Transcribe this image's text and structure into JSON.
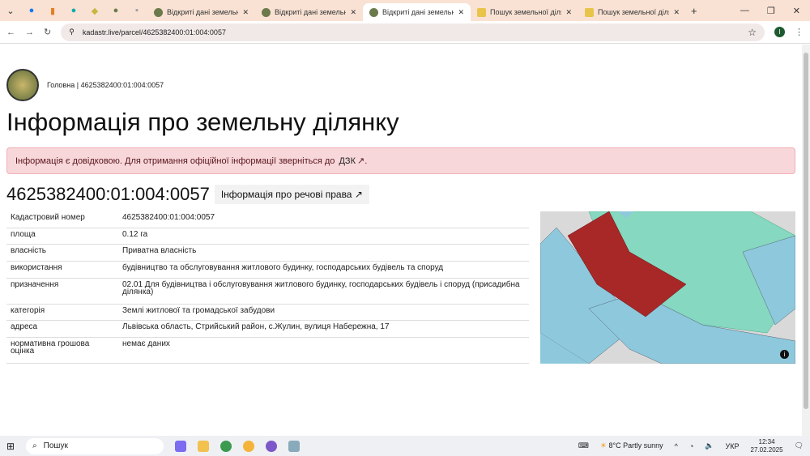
{
  "browser": {
    "tabs": [
      {
        "title": "Відкриті дані земельного",
        "active": false
      },
      {
        "title": "Відкриті дані земельного",
        "active": false
      },
      {
        "title": "Відкриті дані земельного",
        "active": true
      },
      {
        "title": "Пошук земельної ділянки",
        "active": false
      },
      {
        "title": "Пошук земельної ділянки",
        "active": false
      }
    ],
    "url": "kadastr.live/parcel/4625382400:01:004:0057",
    "profile_initial": "I"
  },
  "breadcrumb": {
    "home": "Головна",
    "separator": "|",
    "current": "4625382400:01:004:0057"
  },
  "title": "Інформація про земельну ділянку",
  "alert": {
    "text": "Інформація є довідковою. Для отримання офіційної інформації зверніться до",
    "link": "ДЗК",
    "end": "."
  },
  "parcel": {
    "number": "4625382400:01:004:0057",
    "rights_button": "Інформація про речові права"
  },
  "rows": [
    {
      "label": "Кадастровий номер",
      "value": "4625382400:01:004:0057"
    },
    {
      "label": "площа",
      "value": "0.12 га"
    },
    {
      "label": "власність",
      "value": "Приватна власність"
    },
    {
      "label": "використання",
      "value": "будівництво та обслуговування житлового будинку, господарських будівель та споруд"
    },
    {
      "label": "призначення",
      "value": "02.01 Для будівництва і обслуговування житлового будинку, господарських будівель і споруд (присадибна ділянка)"
    },
    {
      "label": "категорія",
      "value": "Землі житлової та громадської забудови"
    },
    {
      "label": "адреса",
      "value": "Львівська область, Стрийський район, с.Жулин, вулиця Набережна, 17"
    },
    {
      "label": "нормативна грошова оцінка",
      "value": "немає даних"
    }
  ],
  "taskbar": {
    "search": "Пошук",
    "weather": "8°C  Partly sunny",
    "lang": "УКР",
    "time": "12:34",
    "date": "27.02.2025"
  }
}
